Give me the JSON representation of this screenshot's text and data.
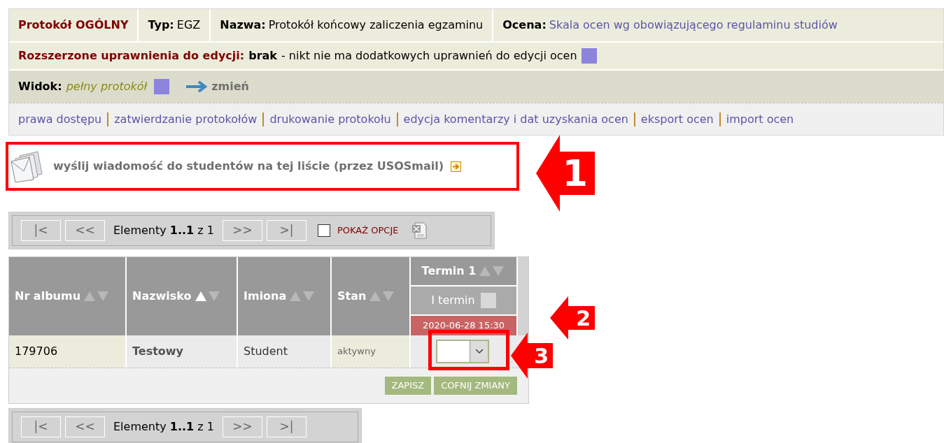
{
  "header": {
    "title": "Protokół OGÓLNY",
    "type_label": "Typ:",
    "type_value": "EGZ",
    "name_label": "Nazwa:",
    "name_value": "Protokół końcowy zaliczenia egzaminu",
    "grade_label": "Ocena:",
    "grade_value": "Skala ocen wg obowiązującego regulaminu studiów"
  },
  "permissions": {
    "label": "Rozszerzone uprawnienia do edycji:",
    "value": "brak",
    "description": "- nikt nie ma dodatkowych uprawnień do edycji ocen"
  },
  "view": {
    "label": "Widok:",
    "value": "pełny protokół",
    "change": "zmień"
  },
  "links": [
    "prawa dostępu",
    "zatwierdzanie protokołów",
    "drukowanie protokołu",
    "edycja komentarzy i dat uzyskania ocen",
    "eksport ocen",
    "import ocen"
  ],
  "mail_link": "wyślij wiadomość do studentów na tej liście (przez USOSmail)",
  "pager_top": {
    "buttons": [
      "|<",
      "<<",
      ">>",
      ">|"
    ],
    "count": "Elementy **1..1** z 1",
    "show_options": {
      "label": "POKAŻ OPCJE",
      "checked": false
    }
  },
  "table": {
    "columns": [
      {
        "label": "Nr albumu",
        "sorted": false
      },
      {
        "label": "Nazwisko",
        "sorted": true
      },
      {
        "label": "Imiona",
        "sorted": false
      },
      {
        "label": "Stan",
        "sorted": false
      }
    ],
    "term": {
      "label": "Termin 1",
      "sorted": false,
      "name": "I termin",
      "date": "2020-06-28 15:30"
    },
    "rows": [
      {
        "album": "179706",
        "surname": "Testowy",
        "names": "Student",
        "status": "aktywny"
      }
    ],
    "buttons": [
      "ZAPISZ",
      "COFNIJ ZMIANY"
    ]
  },
  "pager_bottom": {
    "buttons": [
      "|<",
      "<<",
      ">>",
      ">|"
    ],
    "count": "Elementy **1..1** z 1"
  },
  "annotations": [
    {
      "label": "1"
    },
    {
      "label": "2"
    },
    {
      "label": "3"
    }
  ]
}
